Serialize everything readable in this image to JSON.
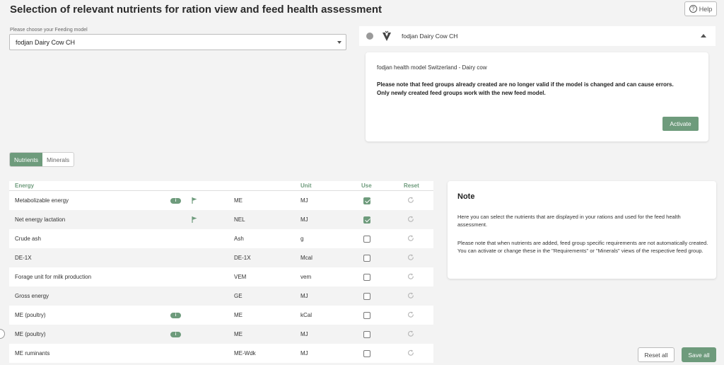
{
  "header": {
    "title": "Selection of relevant nutrients for ration view and feed health assessment",
    "help_label": "Help",
    "help_icon": "question-circle-icon"
  },
  "model_select": {
    "label": "Please choose your Feeding model",
    "value": "fodjan Dairy Cow CH"
  },
  "accordion": {
    "title": "fodjan Dairy Cow CH",
    "model_name": "fodjan health model Switzerland - Dairy cow",
    "warning_line1": "Please note that feed groups already created are no longer valid if the model is changed and can cause errors.",
    "warning_line2": "Only newly created feed groups work with the new feed model.",
    "activate_label": "Activate"
  },
  "tabs": [
    {
      "label": "Nutrients",
      "active": true
    },
    {
      "label": "Minerals",
      "active": false
    }
  ],
  "table": {
    "headers": {
      "name": "Energy",
      "unit": "Unit",
      "use": "Use",
      "reset": "Reset"
    },
    "rows": [
      {
        "name": "Metabolizable energy",
        "info": true,
        "flag": true,
        "abbr": "ME",
        "unit": "MJ",
        "use": true
      },
      {
        "name": "Net energy lactation",
        "info": false,
        "flag": true,
        "abbr": "NEL",
        "unit": "MJ",
        "use": true
      },
      {
        "name": "Crude ash",
        "info": false,
        "flag": false,
        "abbr": "Ash",
        "unit": "g",
        "use": false
      },
      {
        "name": "DE-1X",
        "info": false,
        "flag": false,
        "abbr": "DE-1X",
        "unit": "Mcal",
        "use": false
      },
      {
        "name": "Forage unit for milk production",
        "info": false,
        "flag": false,
        "abbr": "VEM",
        "unit": "vem",
        "use": false
      },
      {
        "name": "Gross energy",
        "info": false,
        "flag": false,
        "abbr": "GE",
        "unit": "MJ",
        "use": false
      },
      {
        "name": "ME (poultry)",
        "info": true,
        "flag": false,
        "abbr": "ME",
        "unit": "kCal",
        "use": false
      },
      {
        "name": "ME (poultry)",
        "info": true,
        "flag": false,
        "abbr": "ME",
        "unit": "MJ",
        "use": false
      },
      {
        "name": "ME ruminants",
        "info": false,
        "flag": false,
        "abbr": "ME-Wdk",
        "unit": "MJ",
        "use": false
      }
    ],
    "info_glyph": "i"
  },
  "note": {
    "title": "Note",
    "p1": "Here you can select the nutrients that are displayed in your rations and used for the feed health assessment.",
    "p2": "Please note that when nutrients are added, feed group specific requirements are not automatically created. You can activate or change these in the \"Requirements\" or \"Minerals\" views of the respective feed group."
  },
  "footer": {
    "reset_all_label": "Reset all",
    "save_all_label": "Save all"
  },
  "colors": {
    "accent": "#6e9b7c",
    "background": "#f3f3f3"
  }
}
